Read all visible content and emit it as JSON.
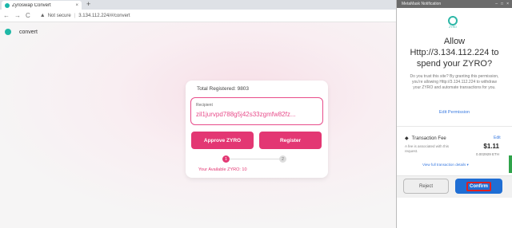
{
  "browser": {
    "tab_title": "Zyroswap Convert",
    "tab_close": "×",
    "new_tab": "+",
    "back": "←",
    "forward": "→",
    "reload": "C",
    "not_secure": "Not secure",
    "separator": "|",
    "url": "3.134.112.224/#/convert"
  },
  "page": {
    "brand_name": "convert"
  },
  "card": {
    "total_registered": "Total Registered: 9803",
    "recipient_label": "Recipient",
    "recipient_value": "zil1jurvpd788g5j42s33zgmfw82fz...",
    "approve_label": "Approve ZYRO",
    "register_label": "Register",
    "step1": "1",
    "step2": "2",
    "available": "Your Available ZYRO: 10"
  },
  "metamask": {
    "window_title": "MetaMask Notification",
    "window_controls": [
      "–",
      "□",
      "×"
    ],
    "icon_label": "ZYRO",
    "heading": "Allow Http://3.134.112.224 to spend your ZYRO?",
    "description": "Do you trust this site? By granting this permission, you're allowing Http://3.134.112.224 to withdraw your ZYRO and automate transactions for you.",
    "edit_permission": "Edit Permission",
    "fee_title": "Transaction Fee",
    "fee_edit": "Edit",
    "fee_note": "A fee is associated with this request.",
    "fee_usd": "$1.11",
    "fee_eth": "0.002929 ETH",
    "view_details": "View full transaction details ▾",
    "reject_label": "Reject",
    "confirm_label": "Confirm",
    "colors": {
      "accent_pink": "#e33773",
      "confirm_blue": "#1f6ed4",
      "highlight_red": "#e02020"
    }
  }
}
